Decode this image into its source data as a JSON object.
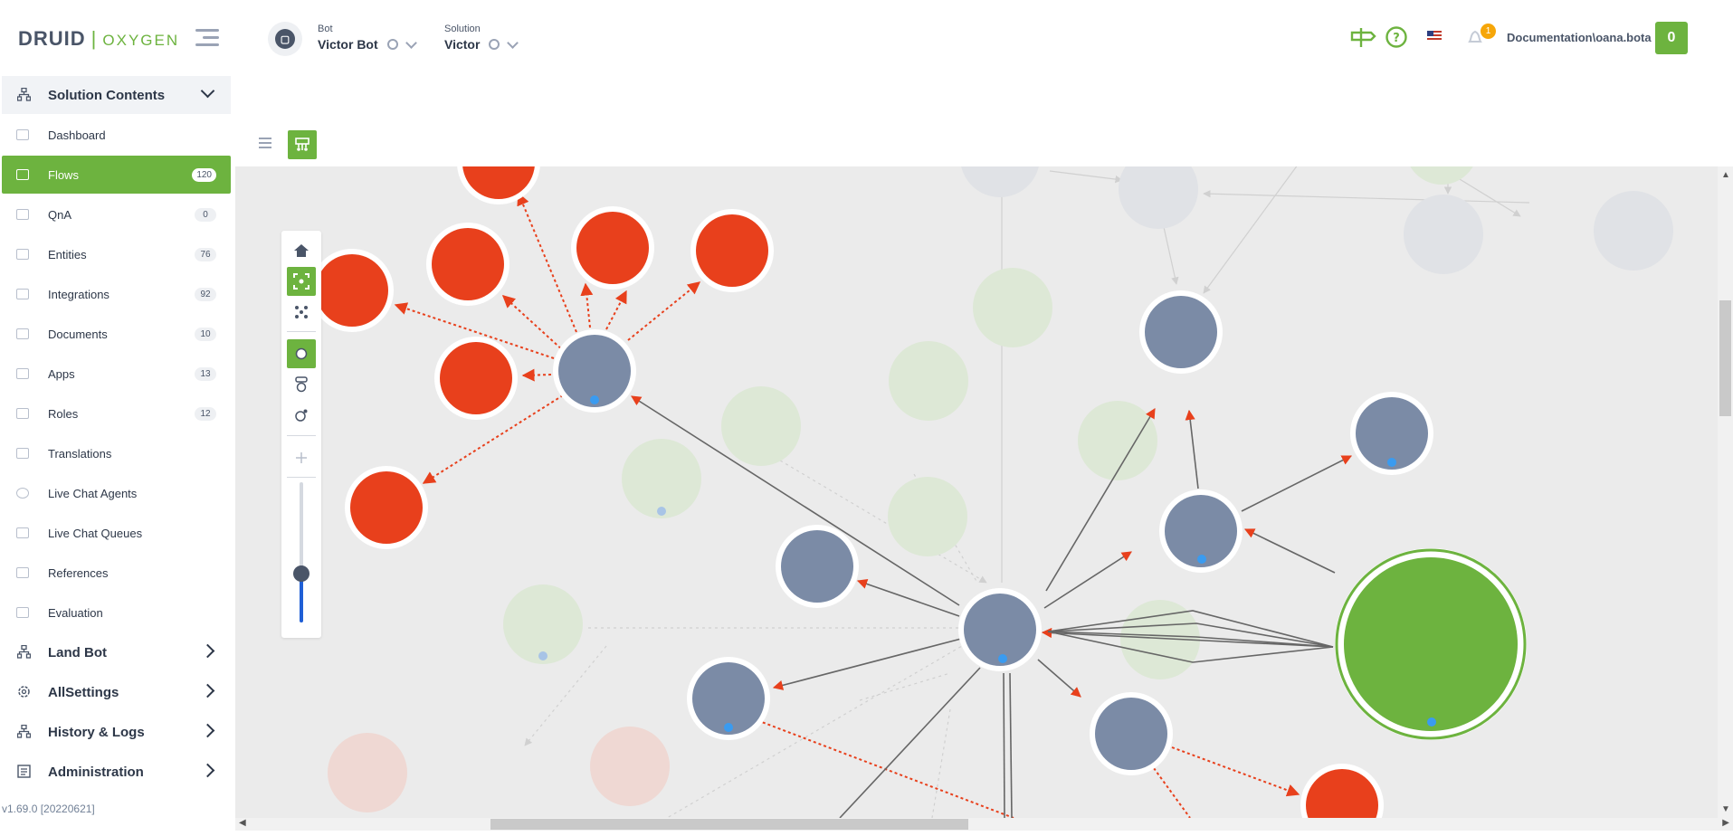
{
  "header": {
    "logo_brand": "DRUID",
    "logo_separator": "|",
    "logo_product": "OXYGEN",
    "bot_label": "Bot",
    "bot_value": "Victor Bot",
    "solution_label": "Solution",
    "solution_value": "Victor",
    "notifications_count": "1",
    "user": "Documentation\\oana.bota",
    "score_button": "0",
    "icons": [
      "signpost-icon",
      "help-icon",
      "us-flag-icon",
      "bell-icon"
    ]
  },
  "sidebar": {
    "sections": [
      {
        "label": "Solution Contents",
        "icon": "sitemap-icon",
        "open": true
      },
      {
        "label": "Land Bot",
        "icon": "sitemap-icon",
        "open": false
      },
      {
        "label": "AllSettings",
        "icon": "gear-icon",
        "open": false
      },
      {
        "label": "History & Logs",
        "icon": "sitemap-icon",
        "open": false
      },
      {
        "label": "Administration",
        "icon": "admin-icon",
        "open": false
      }
    ],
    "items": [
      {
        "label": "Dashboard",
        "count": ""
      },
      {
        "label": "Flows",
        "count": "120",
        "active": true
      },
      {
        "label": "QnA",
        "count": "0"
      },
      {
        "label": "Entities",
        "count": "76"
      },
      {
        "label": "Integrations",
        "count": "92"
      },
      {
        "label": "Documents",
        "count": "10"
      },
      {
        "label": "Apps",
        "count": "13"
      },
      {
        "label": "Roles",
        "count": "12"
      },
      {
        "label": "Translations",
        "count": ""
      },
      {
        "label": "Live Chat Agents",
        "count": ""
      },
      {
        "label": "Live Chat Queues",
        "count": ""
      },
      {
        "label": "References",
        "count": ""
      },
      {
        "label": "Evaluation",
        "count": ""
      }
    ],
    "version": "v1.69.0 [20220621]"
  },
  "graph": {
    "colors": {
      "flow_node": "#7b8ba6",
      "step_node": "#e8401c",
      "root_node": "#6db33f",
      "faded_green": "#dde8d6",
      "faded_grey": "#e0e2e6",
      "faded_red": "#efd8d3",
      "edge": "#666666",
      "edge_dashed": "#e8401c",
      "marker": "#3a9bf0"
    },
    "toolbox_icons": [
      "home-icon",
      "fit-view-icon",
      "scatter-icon",
      "circle-layout-icon",
      "stack-layout-icon",
      "orbit-layout-icon",
      "plus-icon",
      "zoom-slider"
    ],
    "zoom_level": 0.35
  }
}
